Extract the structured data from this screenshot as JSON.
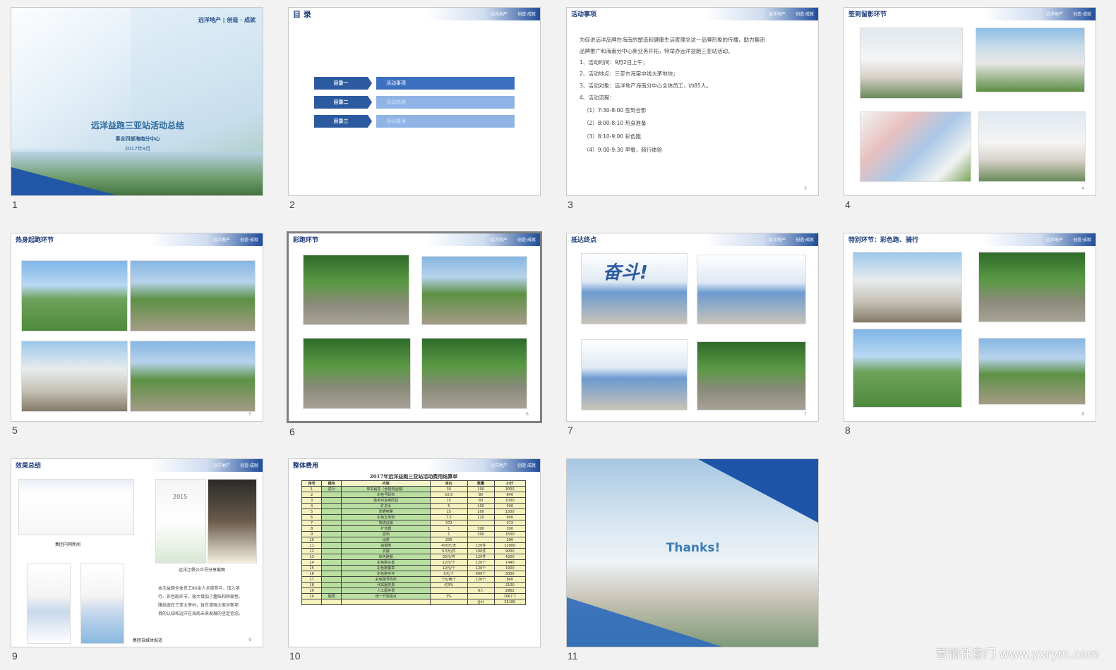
{
  "slides": [
    {
      "num": "1",
      "cover_logo": "远洋地产 | 创造 · 成就",
      "title": "远洋益跑三亚站活动总结",
      "subtitle": "事业四部海南分中心",
      "date": "2017年9月"
    },
    {
      "num": "2",
      "title": "目 录",
      "logo": "远洋地产",
      "logo2": "创造·成就",
      "toc": [
        {
          "a": "目录一",
          "b": "活动事项"
        },
        {
          "a": "目录二",
          "b": "活动总结"
        },
        {
          "a": "目录三",
          "b": "活动费用"
        }
      ]
    },
    {
      "num": "3",
      "title": "活动事项",
      "logo": "远洋地产",
      "logo2": "创造·成就",
      "page": "3",
      "lines": [
        "为促进远洋品牌在海南的塑造和健康生活家理念这一品牌形象的传播，助力集团",
        "品牌推广和海南分中心新业务开拓，特举办远洋益跑三亚站活动。",
        "1、活动时间：9月2日上午；",
        "2、活动地点：三亚市海棠中线大茅地块；",
        "3、活动对象：远洋地产海南分中心全体员工，约85人。",
        "4、活动流程：",
        "（1）7:30-8:00 签到合影",
        "（2）8:00-8:10 热身准备",
        "（3）8:10-9:00 彩色跑",
        "（4）9:00-9:30 早餐，骑行体验"
      ]
    },
    {
      "num": "4",
      "title": "签到留影环节",
      "logo": "远洋地产",
      "logo2": "创造·成就",
      "page": "4"
    },
    {
      "num": "5",
      "title": "热身起跑环节",
      "logo": "远洋地产",
      "logo2": "创造·成就",
      "page": "5"
    },
    {
      "num": "6",
      "title": "彩跑环节",
      "logo": "远洋地产",
      "logo2": "创造·成就",
      "page": "6"
    },
    {
      "num": "7",
      "title": "抵达终点",
      "logo": "远洋地产",
      "logo2": "创造·成就",
      "page": "7",
      "banner": "奋斗!"
    },
    {
      "num": "8",
      "title": "特别环节：彩色跑、骑行",
      "logo": "远洋地产",
      "logo2": "创造·成就",
      "page": "8"
    },
    {
      "num": "9",
      "title": "效果总结",
      "logo": "远洋地产",
      "logo2": "创造·成就",
      "page": "9",
      "cap1": "集团内网新闻",
      "cap2": "远洋之帆公众号分享截图",
      "cap3": "集团自媒体报道",
      "year": "2015",
      "summary": [
        "本次益跑全体员工80余人全部参与，加入项",
        "行、彩色跑环节，极大增加了趣味和积极性。",
        "路线选在三亚大茅村，旨在增强大家对新项",
        "目的认知和远洋在海南未来发展的坚定信念。"
      ]
    },
    {
      "num": "10",
      "title": "整体费用",
      "logo": "远洋地产",
      "logo2": "创造·成就",
      "table_title": "2017年远洋益跑三亚站活动费用结算单",
      "headers": [
        "序号",
        "模块",
        "内容",
        "单价",
        "数量",
        "小计"
      ],
      "rows": [
        [
          "1",
          "前行",
          "单车租赁（含物流运输）",
          "30",
          "100",
          "3000"
        ],
        [
          "2",
          "",
          "彩色号码布",
          "10.5",
          "80",
          "840"
        ],
        [
          "3",
          "",
          "签到可复用防具",
          "15",
          "80",
          "1000"
        ],
        [
          "4",
          "",
          "矿泉水",
          "5",
          "100",
          "500"
        ],
        [
          "5",
          "",
          "防晒喷雾",
          "15",
          "100",
          "1500"
        ],
        [
          "6",
          "",
          "彩色玉米粉",
          "7.5",
          "120",
          "900"
        ],
        [
          "7",
          "",
          "物流运输",
          "372",
          "",
          "372"
        ],
        [
          "8",
          "",
          "扩音器",
          "1",
          "300",
          "300"
        ],
        [
          "9",
          "",
          "音响",
          "1",
          "300",
          "1500"
        ],
        [
          "10",
          "",
          "运费",
          "200",
          "",
          "200"
        ],
        [
          "11",
          "",
          "拍摄类",
          "400元/天",
          "120件",
          "12000"
        ],
        [
          "12",
          "",
          "衣服",
          "9.5元/件",
          "100件",
          "9000"
        ],
        [
          "13",
          "",
          "彩色跑服",
          "35元/件",
          "120件",
          "4200"
        ],
        [
          "14",
          "",
          "彩色跑头套",
          "12元/个",
          "120个",
          "1440"
        ],
        [
          "15",
          "",
          "彩色跑徽章",
          "12元/个",
          "120个",
          "1900"
        ],
        [
          "16",
          "",
          "彩色跑手环",
          "5元/个",
          "600个",
          "3000"
        ],
        [
          "17",
          "",
          "彩色跑号码布",
          "7元/两个",
          "120个",
          "840"
        ],
        [
          "18",
          "",
          "代采服务费",
          "约3%",
          "",
          "2100"
        ],
        [
          "19",
          "",
          "人工服务费",
          "",
          "6人",
          "2862"
        ],
        [
          "20",
          "税费",
          "统一开票税点",
          "3%",
          "",
          "1667.7"
        ]
      ],
      "total_label": "合计",
      "total": "55180"
    },
    {
      "num": "11",
      "thanks": "Thanks!"
    }
  ],
  "watermark": "营销任意门 www.yxrym.com"
}
